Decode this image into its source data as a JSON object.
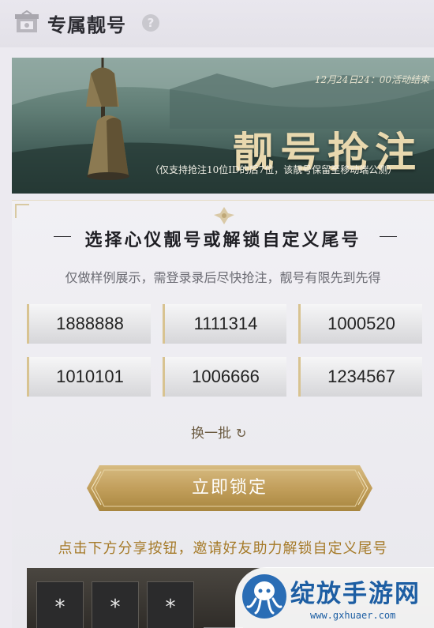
{
  "header": {
    "title": "专属靓号",
    "help_glyph": "?"
  },
  "banner": {
    "date_text": "12月24日24：00活动结束",
    "title": "靓号抢注",
    "note": "（仅支持抢注10位ID的后7位，该靓号保留至移动端公测）"
  },
  "card": {
    "section_title": "选择心仪靓号或解锁自定义尾号",
    "subtitle": "仅做样例展示，需登录录后尽快抢注，靓号有限先到先得",
    "numbers": [
      "1888888",
      "1111314",
      "1000520",
      "1010101",
      "1006666",
      "1234567"
    ],
    "refresh_label": "换一批",
    "refresh_icon": "↻",
    "lock_button_label": "立即锁定",
    "invite_text": "点击下方分享按钮，邀请好友助力解锁自定义尾号",
    "tail_slots": [
      "*",
      "*",
      "*"
    ]
  },
  "watermark": {
    "text": "绽放手游网",
    "url": "www.gxhuaer.com"
  },
  "colors": {
    "gold": "#c9a766",
    "invite": "#a57a28",
    "brand_blue": "#1d5ea3"
  }
}
